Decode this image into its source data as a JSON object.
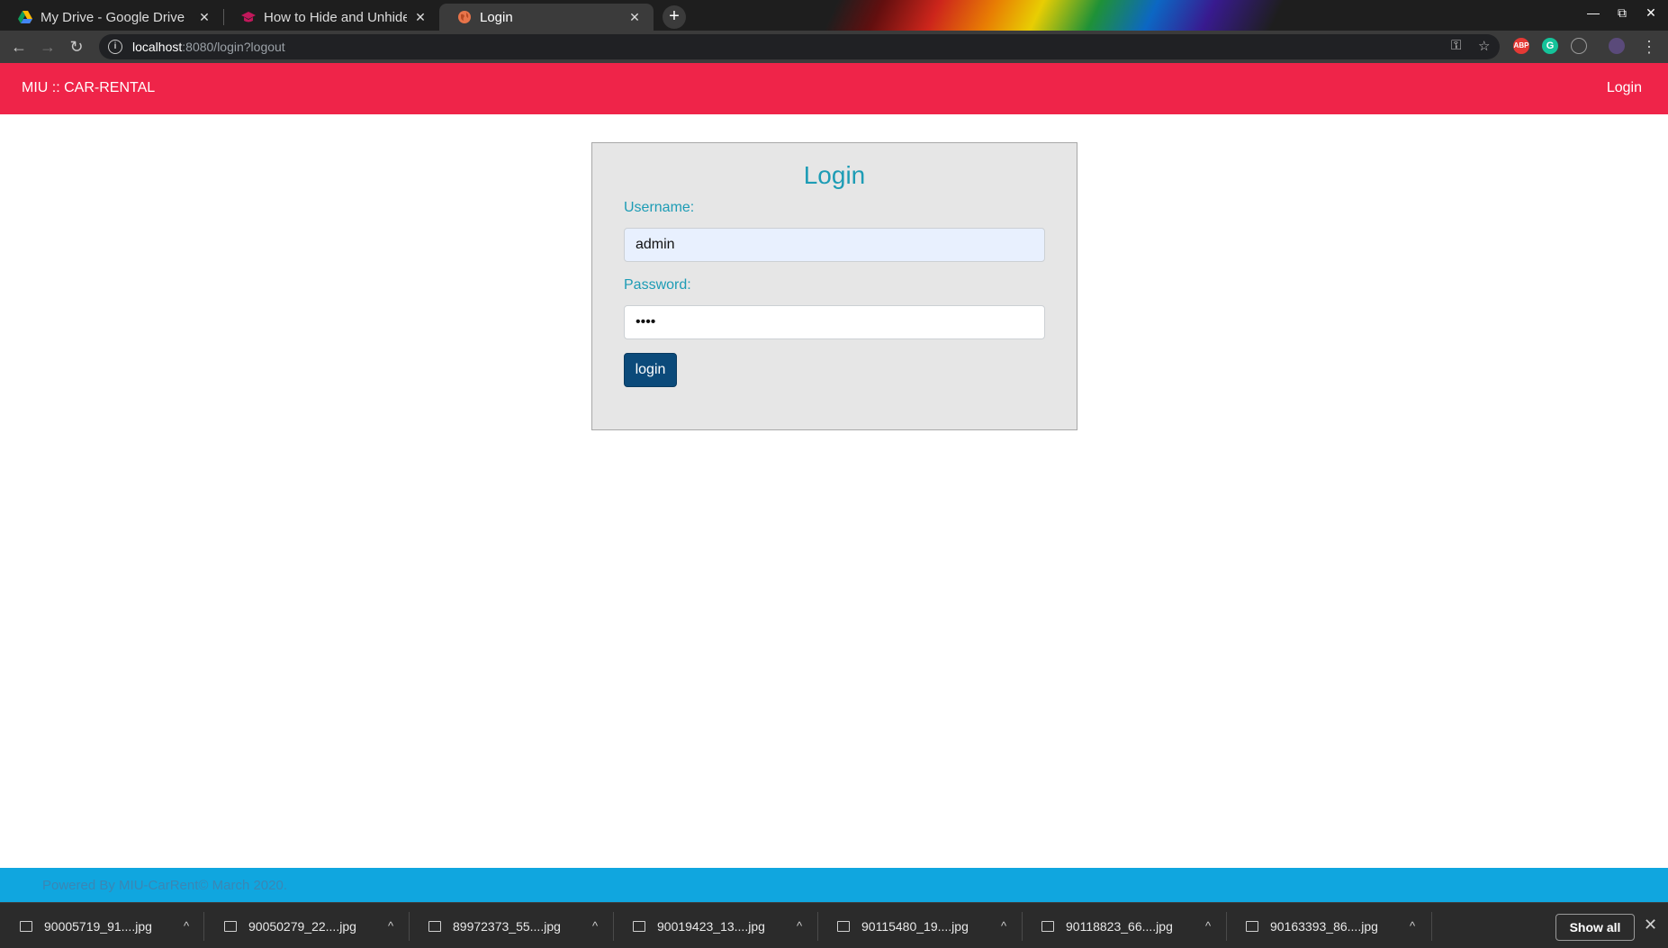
{
  "browser": {
    "tabs": [
      {
        "title": "My Drive - Google Drive",
        "icon": "google-drive-icon"
      },
      {
        "title": "How to Hide and Unhide F",
        "icon": "graduation-cap-icon"
      },
      {
        "title": "Login",
        "icon": "globe-icon",
        "active": true
      }
    ],
    "new_tab_label": "+",
    "tab_close_glyph": "✕",
    "window_controls": {
      "minimize": "—",
      "maximize": "⧉",
      "close": "✕"
    },
    "address": {
      "host": "localhost",
      "path": ":8080/login?logout"
    },
    "extensions": [
      "ABP",
      "G",
      ""
    ]
  },
  "site": {
    "brand": "MIU :: CAR-RENTAL",
    "nav_login": "Login",
    "accent_color": "#ef2449",
    "login_form": {
      "title": "Login",
      "username_label": "Username:",
      "username_value": "admin",
      "password_label": "Password:",
      "password_value": "••••",
      "submit_label": "login"
    },
    "footer": "Powered By MIU-CarRent© March 2020."
  },
  "downloads": {
    "items": [
      "90005719_91....jpg",
      "90050279_22....jpg",
      "89972373_55....jpg",
      "90019423_13....jpg",
      "90115480_19....jpg",
      "90118823_66....jpg",
      "90163393_86....jpg"
    ],
    "caret_glyph": "^",
    "show_all_label": "Show all",
    "close_glyph": "✕"
  }
}
